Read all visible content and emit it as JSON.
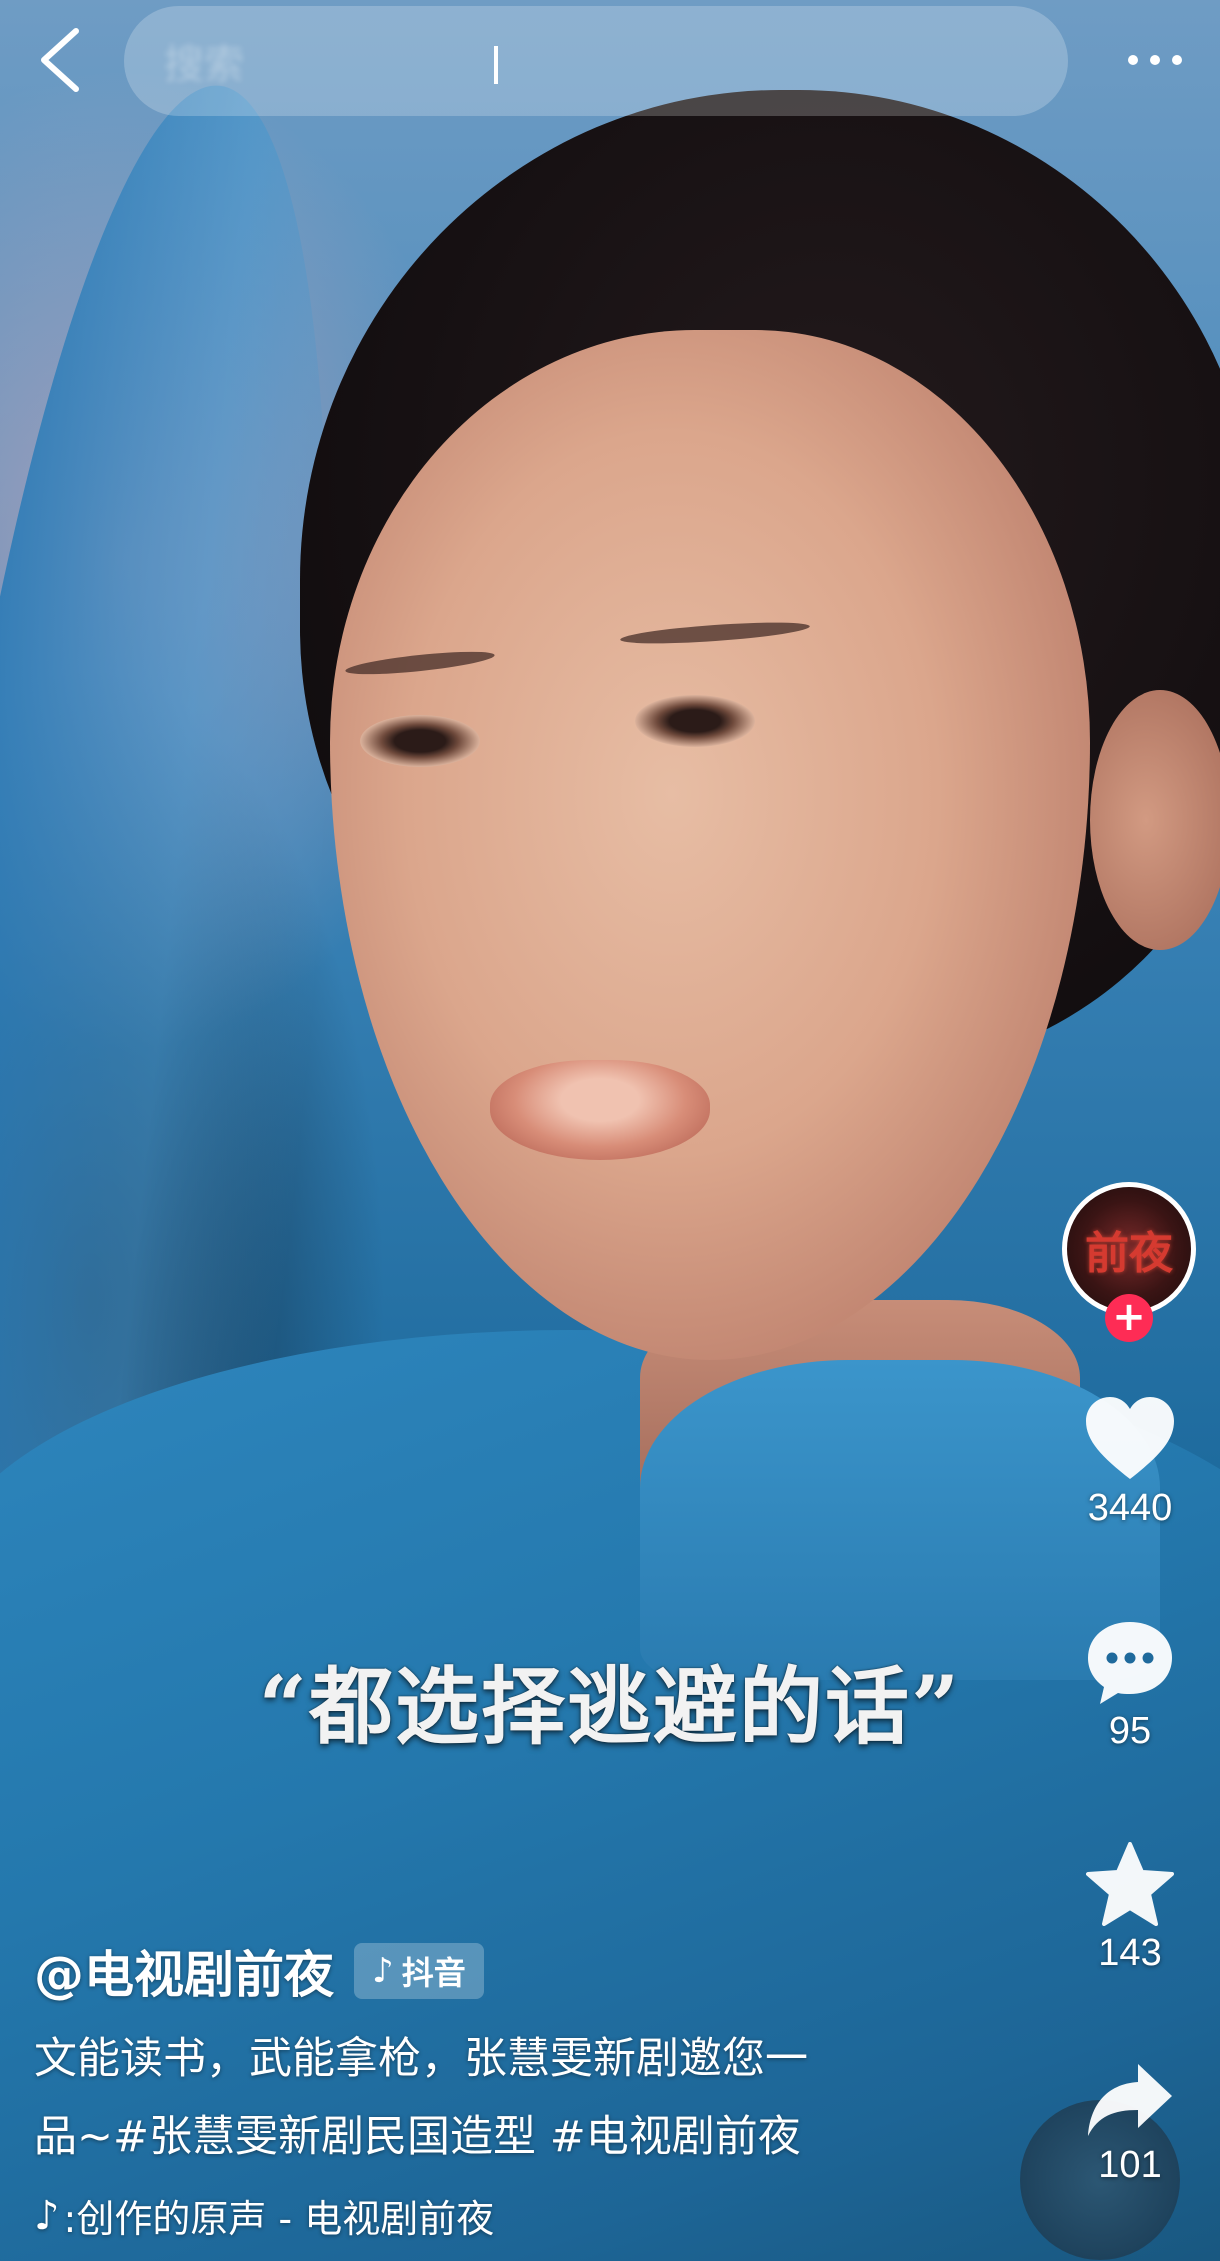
{
  "search": {
    "placeholder": "搜索"
  },
  "video": {
    "subtitle": "“都选择逃避的话”"
  },
  "author": {
    "handle": "@电视剧前夜",
    "avatar_text": "前夜",
    "platform_label": "抖音"
  },
  "caption": {
    "line1": "文能读书，武能拿枪，张慧雯新剧邀您一",
    "line2": "品~#张慧雯新剧民国造型 #电视剧前夜"
  },
  "music": {
    "text": ":创作的原声 - 电视剧前夜"
  },
  "actions": {
    "likes": "3440",
    "comments": "95",
    "favorites": "143",
    "shares": "101"
  },
  "icons": {
    "back": "chevron-left-icon",
    "more": "more-dots-icon",
    "like": "heart-icon",
    "comment": "comment-bubble-icon",
    "favorite": "star-icon",
    "share": "share-arrow-icon",
    "follow": "plus-icon",
    "music": "music-note-icon"
  },
  "colors": {
    "accent": "#fe2c55",
    "icon_fill": "#ffffff"
  }
}
